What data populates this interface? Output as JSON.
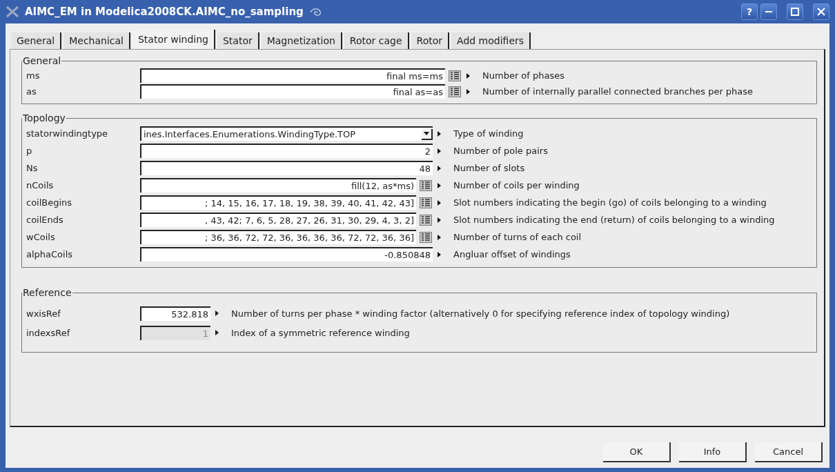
{
  "window": {
    "title": "AIMC_EM in Modelica2008CK.AIMC_no_sampling",
    "help_button": "?"
  },
  "tabs": [
    {
      "label": "General",
      "selected": false
    },
    {
      "label": "Mechanical",
      "selected": false
    },
    {
      "label": "Stator winding",
      "selected": true
    },
    {
      "label": "Stator",
      "selected": false
    },
    {
      "label": "Magnetization",
      "selected": false
    },
    {
      "label": "Rotor cage",
      "selected": false
    },
    {
      "label": "Rotor",
      "selected": false
    },
    {
      "label": "Add modifiers",
      "selected": false
    }
  ],
  "groups": [
    {
      "title": "General",
      "params": [
        {
          "name": "ms",
          "kind": "text",
          "value": "final ms=ms",
          "table_button": true,
          "disabled": false,
          "description": "Number of phases"
        },
        {
          "name": "as",
          "kind": "text",
          "value": "final as=as",
          "table_button": true,
          "disabled": false,
          "description": "Number of internally parallel connected branches per phase"
        }
      ]
    },
    {
      "title": "Topology",
      "params": [
        {
          "name": "statorwindingtype",
          "kind": "combo",
          "value": "ines.Interfaces.Enumerations.WindingType.TOP",
          "table_button": false,
          "disabled": false,
          "description": "Type of winding"
        },
        {
          "name": "p",
          "kind": "text",
          "value": "2",
          "table_button": false,
          "disabled": false,
          "description": "Number of pole pairs"
        },
        {
          "name": "Ns",
          "kind": "text",
          "value": "48",
          "table_button": false,
          "disabled": false,
          "description": "Number of slots"
        },
        {
          "name": "nCoils",
          "kind": "text",
          "value": "fill(12, as*ms)",
          "table_button": true,
          "disabled": false,
          "description": "Number of coils per winding"
        },
        {
          "name": "coilBegins",
          "kind": "text",
          "value": "; 14, 15, 16, 17, 18, 19, 38, 39, 40, 41, 42, 43]",
          "table_button": true,
          "disabled": false,
          "description": "Slot numbers indicating the begin (go) of coils belonging to a winding"
        },
        {
          "name": "coilEnds",
          "kind": "text",
          "value": ", 43, 42; 7, 6, 5, 28, 27, 26, 31, 30, 29, 4, 3, 2]",
          "table_button": true,
          "disabled": false,
          "description": "Slot numbers indicating the end (return) of coils belonging to a winding"
        },
        {
          "name": "wCoils",
          "kind": "text",
          "value": "; 36, 36, 72, 72, 36, 36, 36, 36, 72, 72, 36, 36]",
          "table_button": true,
          "disabled": false,
          "description": "Number of turns of each coil"
        },
        {
          "name": "alphaCoils",
          "kind": "text",
          "value": "-0.850848",
          "table_button": false,
          "disabled": false,
          "description": "Angluar offset of windings"
        }
      ]
    },
    {
      "title": "Reference",
      "params": [
        {
          "name": "wxisRef",
          "kind": "text",
          "value": "532.818",
          "table_button": false,
          "disabled": false,
          "description": "Number of turns per phase * winding factor (alternatively 0 for specifying reference index of topology winding)"
        },
        {
          "name": "indexsRef",
          "kind": "text",
          "value": "1",
          "table_button": false,
          "disabled": true,
          "description": "Index of a symmetric reference winding"
        }
      ]
    }
  ],
  "buttons": [
    {
      "label": "OK"
    },
    {
      "label": "Info"
    },
    {
      "label": "Cancel"
    }
  ]
}
